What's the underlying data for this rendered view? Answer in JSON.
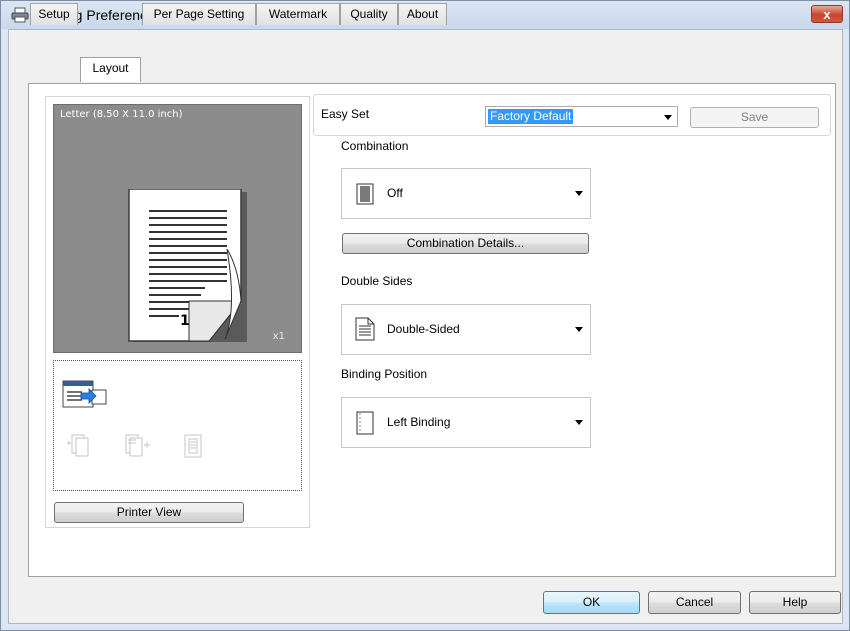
{
  "window": {
    "title": "Printing Preferences",
    "close_label": "x"
  },
  "tabs": [
    {
      "label": "Setup",
      "active": false
    },
    {
      "label": "Layout",
      "active": true
    },
    {
      "label": "Per Page Setting",
      "active": false
    },
    {
      "label": "Watermark",
      "active": false
    },
    {
      "label": "Quality",
      "active": false
    },
    {
      "label": "About",
      "active": false
    }
  ],
  "preview": {
    "paper_label": "Letter  (8.50 X 11.0 inch)",
    "page_number": "1",
    "copies": "x1"
  },
  "printer_view_button": "Printer View",
  "easy_set": {
    "label": "Easy Set",
    "value": "Factory Default",
    "save_label": "Save"
  },
  "combination": {
    "label": "Combination",
    "value": "Off",
    "details_button": "Combination Details..."
  },
  "double_sides": {
    "label": "Double Sides",
    "value": "Double-Sided"
  },
  "binding_position": {
    "label": "Binding Position",
    "value": "Left Binding"
  },
  "footer": {
    "ok": "OK",
    "cancel": "Cancel",
    "help": "Help"
  },
  "colors": {
    "selection": "#3399ff",
    "preview_bg": "#8c8c8c",
    "close_red": "#c9452e"
  }
}
